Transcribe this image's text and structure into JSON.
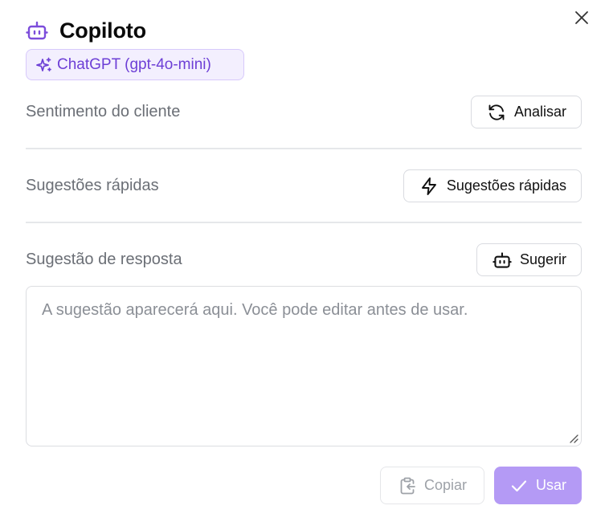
{
  "header": {
    "title": "Copiloto"
  },
  "model_badge": {
    "label": "ChatGPT (gpt-4o-mini)"
  },
  "sections": {
    "sentiment": {
      "label": "Sentimento do cliente",
      "button": "Analisar"
    },
    "quick": {
      "label": "Sugestões rápidas",
      "button": "Sugestões rápidas"
    },
    "reply": {
      "label": "Sugestão de resposta",
      "button": "Sugerir"
    }
  },
  "reply_textarea": {
    "placeholder": "A sugestão aparecerá aqui. Você pode editar antes de usar."
  },
  "footer": {
    "copy_label": "Copiar",
    "use_label": "Usar"
  },
  "colors": {
    "accent": "#7c4ddb",
    "badge_bg": "#f3effe",
    "badge_border": "#d7c9fb",
    "use_button_bg": "#b49af5",
    "muted_text": "#6b6f76"
  },
  "icons": {
    "header": "robot-icon",
    "badge": "sparkles-icon",
    "sentiment": "refresh-icon",
    "quick": "lightning-icon",
    "reply": "robot-icon",
    "copy": "clipboard-icon",
    "use": "check-icon",
    "close": "close-icon"
  }
}
